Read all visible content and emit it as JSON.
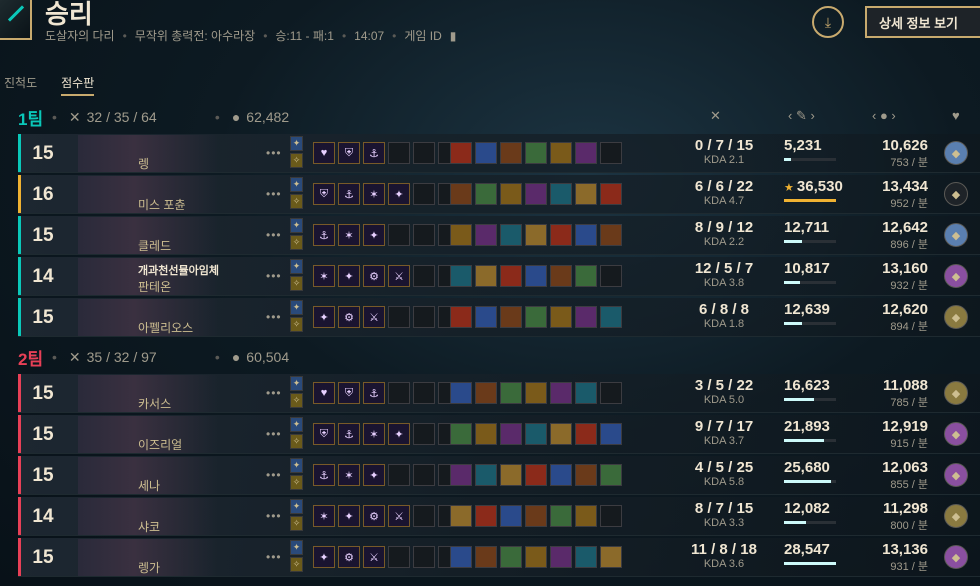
{
  "header": {
    "title": "승리",
    "meta": [
      "도살자의 다리",
      "무작위 총력전: 아수라장",
      "승:11 - 패:1",
      "14:07",
      "게임 ID"
    ],
    "detail_button": "상세 정보 보기",
    "download_icon": "download-icon"
  },
  "tabs": [
    {
      "label": "진척도",
      "active": false
    },
    {
      "label": "점수판",
      "active": true
    }
  ],
  "columns": {
    "kda_icon": "crossed-swords-icon",
    "damage_label": "‹ ✎ ›",
    "gold_label": "‹ ● ›",
    "emblem_icon": "heart-icon"
  },
  "colors": {
    "team1": "#0ac8b9",
    "team2": "#e84057",
    "accent_gold": "#c8aa6e"
  },
  "teams": [
    {
      "name": "1팀",
      "kda": "32 / 35 / 64",
      "gold": "62,482",
      "players": [
        {
          "level": "15",
          "summoner": "",
          "champion": "렝",
          "kda": "0 / 7 / 15",
          "ratio": "KDA 2.1",
          "damage": "5,231",
          "damage_pct": 14,
          "gold": "10,626",
          "gpm": "753 / 분",
          "self": false,
          "emblem": "#5a7fb0"
        },
        {
          "level": "16",
          "summoner": "",
          "champion": "미스 포츈",
          "kda": "6 / 6 / 22",
          "ratio": "KDA 4.7",
          "damage": "36,530",
          "damage_pct": 100,
          "gold": "13,434",
          "gpm": "952 / 분",
          "self": true,
          "emblem": "#1e2328"
        },
        {
          "level": "15",
          "summoner": "",
          "champion": "클레드",
          "kda": "8 / 9 / 12",
          "ratio": "KDA 2.2",
          "damage": "12,711",
          "damage_pct": 35,
          "gold": "12,642",
          "gpm": "896 / 분",
          "self": false,
          "emblem": "#5a7fb0"
        },
        {
          "level": "14",
          "summoner": "개과천선뮬아임체",
          "champion": "판테온",
          "kda": "12 / 5 / 7",
          "ratio": "KDA 3.8",
          "damage": "10,817",
          "damage_pct": 30,
          "gold": "13,160",
          "gpm": "932 / 분",
          "self": false,
          "emblem": "#8a4fa0"
        },
        {
          "level": "15",
          "summoner": "",
          "champion": "아펠리오스",
          "kda": "6 / 8 / 8",
          "ratio": "KDA 1.8",
          "damage": "12,639",
          "damage_pct": 35,
          "gold": "12,620",
          "gpm": "894 / 분",
          "self": false,
          "emblem": "#8a7a40"
        }
      ]
    },
    {
      "name": "2팀",
      "kda": "35 / 32 / 97",
      "gold": "60,504",
      "players": [
        {
          "level": "15",
          "summoner": "",
          "champion": "카서스",
          "kda": "3 / 5 / 22",
          "ratio": "KDA 5.0",
          "damage": "16,623",
          "damage_pct": 58,
          "gold": "11,088",
          "gpm": "785 / 분",
          "self": false,
          "emblem": "#8a7a40"
        },
        {
          "level": "15",
          "summoner": "",
          "champion": "이즈리얼",
          "kda": "9 / 7 / 17",
          "ratio": "KDA 3.7",
          "damage": "21,893",
          "damage_pct": 76,
          "gold": "12,919",
          "gpm": "915 / 분",
          "self": false,
          "emblem": "#8a4fa0"
        },
        {
          "level": "15",
          "summoner": "",
          "champion": "세나",
          "kda": "4 / 5 / 25",
          "ratio": "KDA 5.8",
          "damage": "25,680",
          "damage_pct": 90,
          "gold": "12,063",
          "gpm": "855 / 분",
          "self": false,
          "emblem": "#8a4fa0"
        },
        {
          "level": "14",
          "summoner": "",
          "champion": "샤코",
          "kda": "8 / 7 / 15",
          "ratio": "KDA 3.3",
          "damage": "12,082",
          "damage_pct": 42,
          "gold": "11,298",
          "gpm": "800 / 분",
          "self": false,
          "emblem": "#8a7a40"
        },
        {
          "level": "15",
          "summoner": "",
          "champion": "렝가",
          "kda": "11 / 8 / 18",
          "ratio": "KDA 3.6",
          "damage": "28,547",
          "damage_pct": 100,
          "gold": "13,136",
          "gpm": "931 / 분",
          "self": false,
          "emblem": "#8a4fa0"
        }
      ]
    }
  ]
}
